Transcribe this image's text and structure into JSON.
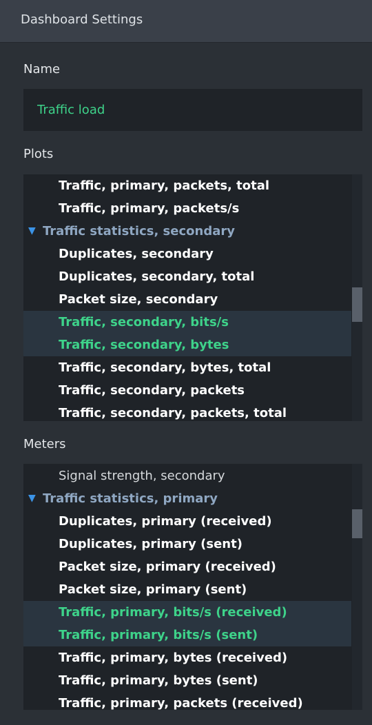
{
  "header": {
    "title": "Dashboard Settings"
  },
  "name_section": {
    "label": "Name",
    "value": "Traffic load"
  },
  "plots": {
    "label": "Plots",
    "rows": [
      {
        "kind": "item",
        "text": "Traffic, primary, packets, total",
        "selected": false
      },
      {
        "kind": "item",
        "text": "Traffic, primary, packets/s",
        "selected": false
      },
      {
        "kind": "group",
        "text": "Traffic statistics, secondary",
        "icon": "triangle-down-icon"
      },
      {
        "kind": "item",
        "text": "Duplicates, secondary",
        "selected": false
      },
      {
        "kind": "item",
        "text": "Duplicates, secondary, total",
        "selected": false
      },
      {
        "kind": "item",
        "text": "Packet size, secondary",
        "selected": false
      },
      {
        "kind": "item",
        "text": "Traffic, secondary, bits/s",
        "selected": true
      },
      {
        "kind": "item",
        "text": "Traffic, secondary, bytes",
        "selected": true
      },
      {
        "kind": "item",
        "text": "Traffic, secondary, bytes, total",
        "selected": false
      },
      {
        "kind": "item",
        "text": "Traffic, secondary, packets",
        "selected": false
      },
      {
        "kind": "item",
        "text": "Traffic, secondary, packets, total",
        "selected": false
      }
    ]
  },
  "meters": {
    "label": "Meters",
    "rows": [
      {
        "kind": "item",
        "text": "Signal strength, secondary",
        "selected": false,
        "plain": true
      },
      {
        "kind": "group",
        "text": "Traffic statistics, primary",
        "icon": "triangle-down-icon"
      },
      {
        "kind": "item",
        "text": "Duplicates, primary (received)",
        "selected": false
      },
      {
        "kind": "item",
        "text": "Duplicates, primary (sent)",
        "selected": false
      },
      {
        "kind": "item",
        "text": "Packet size, primary (received)",
        "selected": false
      },
      {
        "kind": "item",
        "text": "Packet size, primary (sent)",
        "selected": false
      },
      {
        "kind": "item",
        "text": "Traffic, primary, bits/s (received)",
        "selected": true
      },
      {
        "kind": "item",
        "text": "Traffic, primary, bits/s (sent)",
        "selected": true
      },
      {
        "kind": "item",
        "text": "Traffic, primary, bytes (received)",
        "selected": false
      },
      {
        "kind": "item",
        "text": "Traffic, primary, bytes (sent)",
        "selected": false
      },
      {
        "kind": "item",
        "text": "Traffic, primary, packets (received)",
        "selected": false
      }
    ]
  },
  "colors": {
    "accent_green": "#3ed38a",
    "group_arrow": "#3b93e6",
    "background": "#2b3036",
    "field": "#1f2328"
  }
}
